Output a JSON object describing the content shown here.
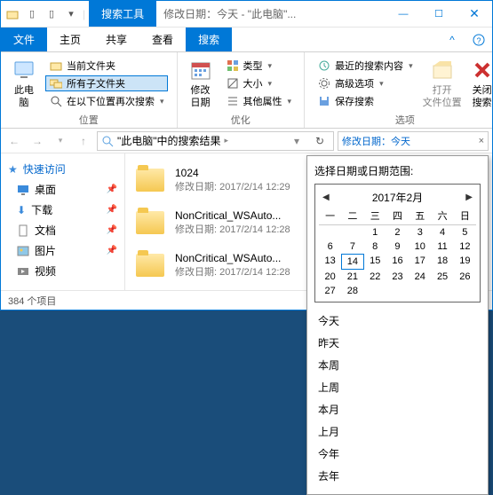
{
  "titlebar": {
    "tool_tab": "搜索工具",
    "title": "修改日期：今天 - \"此电脑\"..."
  },
  "tabs": {
    "file": "文件",
    "home": "主页",
    "share": "共享",
    "view": "查看",
    "search": "搜索"
  },
  "ribbon": {
    "group_location": "位置",
    "this_pc": "此电\n脑",
    "current_folder": "当前文件夹",
    "all_subfolders": "所有子文件夹",
    "search_again_in": "在以下位置再次搜索",
    "group_refine": "优化",
    "date_modified": "修改\n日期",
    "kind": "类型",
    "size": "大小",
    "other_props": "其他属性",
    "group_options": "选项",
    "recent_searches": "最近的搜索内容",
    "advanced_options": "高级选项",
    "save_search": "保存搜索",
    "open_location": "打开\n文件位置",
    "close_search": "关闭\n搜索"
  },
  "address": {
    "path": "\"此电脑\"中的搜索结果",
    "search_text": "修改日期：今天"
  },
  "sidebar": {
    "quick_access": "快速访问",
    "items": [
      {
        "label": "桌面"
      },
      {
        "label": "下载"
      },
      {
        "label": "文档"
      },
      {
        "label": "图片"
      },
      {
        "label": "视频"
      }
    ]
  },
  "files": [
    {
      "name": "1024",
      "meta": "修改日期: 2017/2/14 12:29"
    },
    {
      "name": "NonCritical_WSAuto...",
      "meta": "修改日期: 2017/2/14 12:28"
    },
    {
      "name": "NonCritical_WSAuto...",
      "meta": "修改日期: 2017/2/14 12:28"
    }
  ],
  "status": {
    "count": "384 个项目"
  },
  "datepop": {
    "title": "选择日期或日期范围:",
    "month": "2017年2月",
    "dow": [
      "一",
      "二",
      "三",
      "四",
      "五",
      "六",
      "日"
    ],
    "quick": [
      "今天",
      "昨天",
      "本周",
      "上周",
      "本月",
      "上月",
      "今年",
      "去年"
    ]
  }
}
